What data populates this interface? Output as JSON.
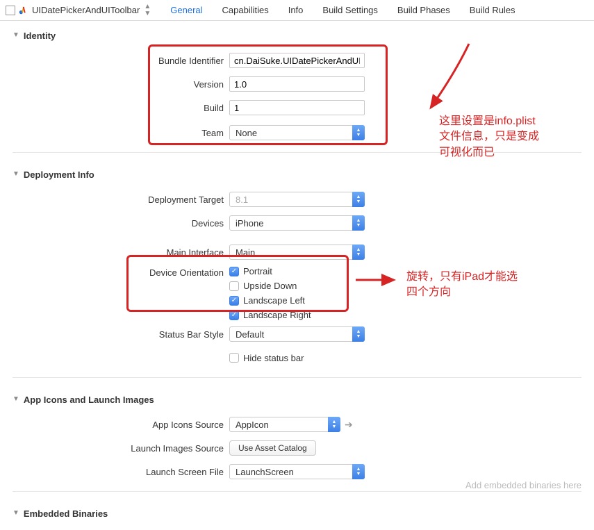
{
  "header": {
    "target_name": "UIDatePickerAndUIToolbar",
    "tabs": [
      "General",
      "Capabilities",
      "Info",
      "Build Settings",
      "Build Phases",
      "Build Rules"
    ],
    "active_tab": 0
  },
  "sections": {
    "identity": {
      "title": "Identity",
      "bundle_identifier_label": "Bundle Identifier",
      "bundle_identifier_value": "cn.DaiSuke.UIDatePickerAndUIToolb",
      "version_label": "Version",
      "version_value": "1.0",
      "build_label": "Build",
      "build_value": "1",
      "team_label": "Team",
      "team_value": "None"
    },
    "deployment": {
      "title": "Deployment Info",
      "deployment_target_label": "Deployment Target",
      "deployment_target_value": "8.1",
      "devices_label": "Devices",
      "devices_value": "iPhone",
      "main_interface_label": "Main Interface",
      "main_interface_value": "Main",
      "orientation_label": "Device Orientation",
      "orientation_options": [
        {
          "label": "Portrait",
          "checked": true
        },
        {
          "label": "Upside Down",
          "checked": false
        },
        {
          "label": "Landscape Left",
          "checked": true
        },
        {
          "label": "Landscape Right",
          "checked": true
        }
      ],
      "status_bar_label": "Status Bar Style",
      "status_bar_value": "Default",
      "hide_status_bar_label": "Hide status bar",
      "hide_status_bar_checked": false
    },
    "app_icons": {
      "title": "App Icons and Launch Images",
      "icons_source_label": "App Icons Source",
      "icons_source_value": "AppIcon",
      "launch_images_label": "Launch Images Source",
      "launch_images_btn": "Use Asset Catalog",
      "launch_screen_label": "Launch Screen File",
      "launch_screen_value": "LaunchScreen"
    },
    "embedded": {
      "title": "Embedded Binaries"
    }
  },
  "annotations": {
    "identity_note": "这里设置是info.plist\n文件信息，只是变成\n可视化而已",
    "orientation_note": "旋转，只有iPad才能选\n四个方向"
  },
  "footer": {
    "hint": "Add embedded binaries here"
  }
}
